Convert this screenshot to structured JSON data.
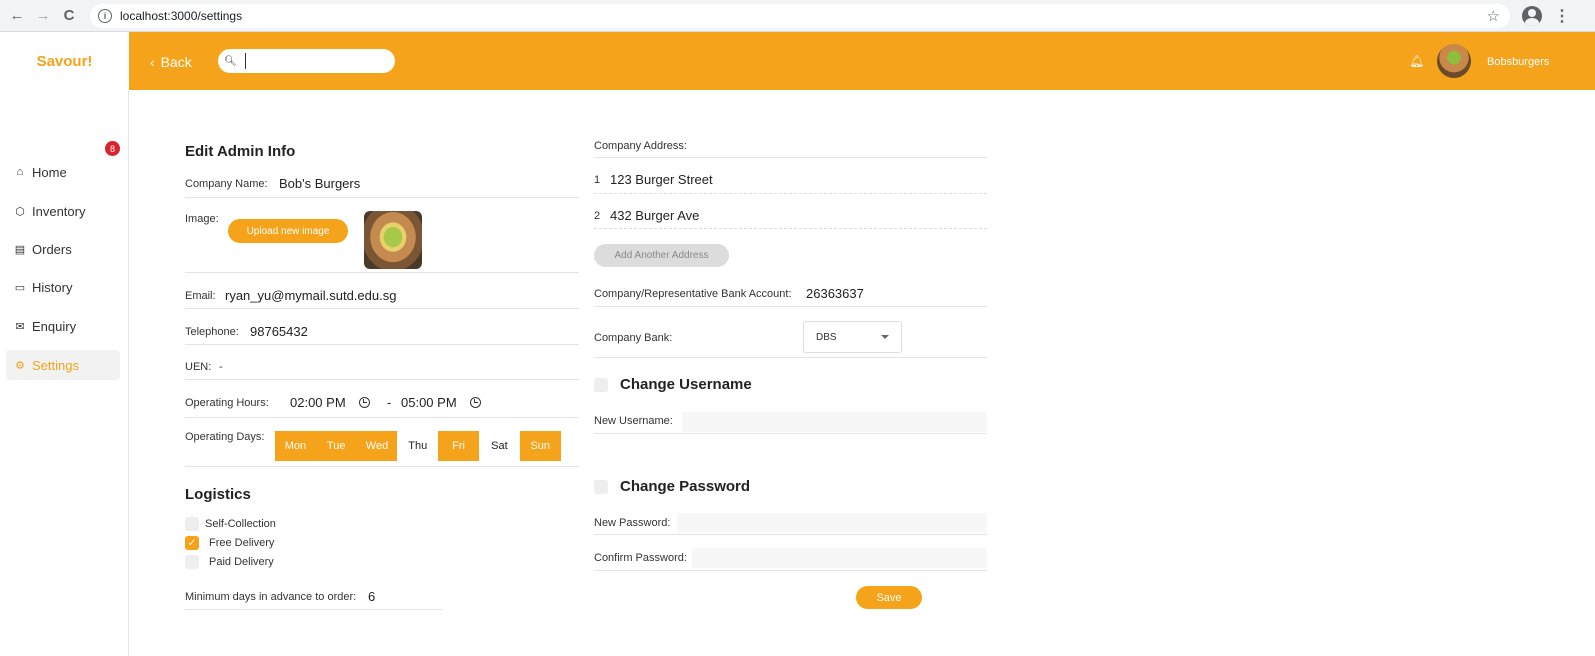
{
  "browser": {
    "url": "localhost:3000/settings",
    "back_icon": "←",
    "forward_icon": "→",
    "reload_icon": "C"
  },
  "app": {
    "logo": "Savour!",
    "back_label": "Back",
    "search_placeholder": "",
    "username": "Bobsburgers",
    "accent": "#f5a31a"
  },
  "sidebar": {
    "items": [
      {
        "label": "Home",
        "icon": "home-icon"
      },
      {
        "label": "Inventory",
        "icon": "cube-icon"
      },
      {
        "label": "Orders",
        "icon": "document-icon"
      },
      {
        "label": "History",
        "icon": "folder-icon"
      },
      {
        "label": "Enquiry",
        "icon": "mail-icon"
      },
      {
        "label": "Settings",
        "icon": "gear-icon"
      }
    ],
    "orders_badge": "8"
  },
  "admin": {
    "title": "Edit Admin Info",
    "company_name_label": "Company Name:",
    "company_name": "Bob's Burgers",
    "image_label": "Image:",
    "upload_label": "Upload new image",
    "email_label": "Email:",
    "email": "ryan_yu@mymail.sutd.edu.sg",
    "telephone_label": "Telephone:",
    "telephone": "98765432",
    "uen_label": "UEN:",
    "uen": "-",
    "hours_label": "Operating Hours:",
    "hours_start": "02:00 PM",
    "hours_sep": "-",
    "hours_end": "05:00 PM",
    "days_label": "Operating Days:",
    "days": [
      {
        "label": "Mon",
        "on": true
      },
      {
        "label": "Tue",
        "on": true
      },
      {
        "label": "Wed",
        "on": true
      },
      {
        "label": "Thu",
        "on": false
      },
      {
        "label": "Fri",
        "on": true
      },
      {
        "label": "Sat",
        "on": false
      },
      {
        "label": "Sun",
        "on": true
      }
    ]
  },
  "logistics": {
    "title": "Logistics",
    "options": [
      {
        "label": "Self-Collection",
        "checked": false
      },
      {
        "label": "Free Delivery",
        "checked": true
      },
      {
        "label": "Paid Delivery",
        "checked": false
      }
    ],
    "min_days_label": "Minimum days in advance to order:",
    "min_days": "6"
  },
  "company": {
    "address_label": "Company Address:",
    "addresses": [
      {
        "index": "1",
        "text": "123 Burger Street"
      },
      {
        "index": "2",
        "text": "432 Burger Ave"
      }
    ],
    "add_address_label": "Add Another Address",
    "bank_account_label": "Company/Representative Bank Account:",
    "bank_account": "26363637",
    "bank_label": "Company Bank:",
    "bank": "DBS"
  },
  "username_section": {
    "title": "Change Username",
    "new_label": "New Username:"
  },
  "password_section": {
    "title": "Change Password",
    "new_label": "New Password:",
    "confirm_label": "Confirm Password:"
  },
  "save_label": "Save"
}
